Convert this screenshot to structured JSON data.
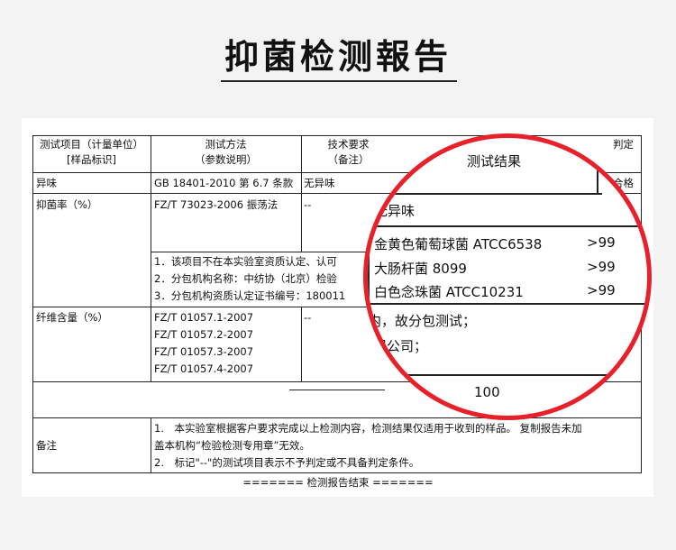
{
  "title": "抑菌检测報告",
  "header": {
    "col1_line1": "测试项目（计量单位）",
    "col1_line2": "[样品标识]",
    "col2_line1": "测试方法",
    "col2_line2": "（参数说明）",
    "col3_line1": "技术要求",
    "col3_line2": "（备注）",
    "col4": "测试结果",
    "col5": "判定"
  },
  "rows": {
    "odor": {
      "item": "异味",
      "method": "GB 18401-2010 第 6.7 条款",
      "requirement": "无异味",
      "verdict": "合格"
    },
    "antibacterial": {
      "item": "抑菌率（%）",
      "method": "FZ/T 73023-2006 振荡法",
      "requirement": "--"
    },
    "notes": [
      "1．该项目不在本实验室资质认定、认可",
      "2．分包机构名称：中纺协（北京）检验",
      "3．分包机构资质认定证书编号：180011"
    ],
    "fiber": {
      "item": "纤维含量（%）",
      "methods": [
        "FZ/T 01057.1-2007",
        "FZ/T 01057.2-2007",
        "FZ/T 01057.3-2007",
        "FZ/T 01057.4-2007"
      ],
      "requirement": "--"
    },
    "total": {
      "value": "100"
    },
    "remarks": {
      "label": "备注",
      "line1": "1.　本实验室根据客户要求完成以上检测内容，检测结果仅适用于收到的样品。 复制报告未加",
      "line2": "盖本机构“检验检测专用章”无效。",
      "line3": "2.　标记\"--\"的测试项目表示不予判定或不具备判定条件。"
    }
  },
  "zoom": {
    "header": "测试结果",
    "odor": "无异味",
    "bacteria": [
      {
        "name": "金黄色葡萄球菌 ATCC6538",
        "value": ">99"
      },
      {
        "name": "大肠杆菌 8099",
        "value": ">99"
      },
      {
        "name": "白色念珠菌 ATCC10231",
        "value": ">99"
      }
    ],
    "partial1": "内，故分包测试；",
    "partial2": "限公司；",
    "total": "100"
  },
  "footer": "======= 检测报告结束 ======="
}
